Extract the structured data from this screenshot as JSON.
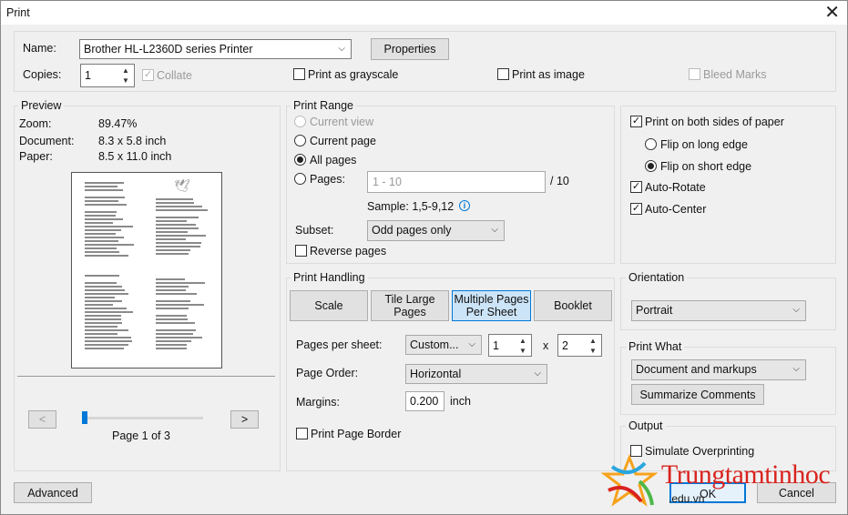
{
  "window": {
    "title": "Print"
  },
  "printer": {
    "name_label": "Name:",
    "name_value": "Brother HL-L2360D series Printer",
    "properties_label": "Properties",
    "copies_label": "Copies:",
    "copies_value": "1",
    "collate_label": "Collate",
    "grayscale_label": "Print as grayscale",
    "as_image_label": "Print as image",
    "bleed_label": "Bleed Marks"
  },
  "preview": {
    "title": "Preview",
    "zoom_label": "Zoom:",
    "zoom_value": "89.47%",
    "document_label": "Document:",
    "document_value": "8.3 x 5.8 inch",
    "paper_label": "Paper:",
    "paper_value": "8.5 x 11.0 inch",
    "prev_label": "<",
    "next_label": ">",
    "page_text": "Page 1 of 3",
    "page_current": 1,
    "page_total": 3
  },
  "range": {
    "title": "Print Range",
    "current_view": "Current view",
    "current_page": "Current page",
    "all_pages": "All pages",
    "pages_label": "Pages:",
    "pages_placeholder": "1 - 10",
    "pages_total": "/ 10",
    "sample": "Sample: 1,5-9,12",
    "subset_label": "Subset:",
    "subset_value": "Odd pages only",
    "reverse_label": "Reverse pages"
  },
  "handling": {
    "title": "Print Handling",
    "tabs": [
      "Scale",
      "Tile Large Pages",
      "Multiple Pages Per Sheet",
      "Booklet"
    ],
    "pps_label": "Pages per sheet:",
    "pps_value": "Custom...",
    "pps_x": "1",
    "pps_times": "x",
    "pps_y": "2",
    "order_label": "Page Order:",
    "order_value": "Horizontal",
    "margins_label": "Margins:",
    "margins_value": "0.200",
    "margins_unit": "inch",
    "border_label": "Print Page Border"
  },
  "duplex": {
    "both_sides": "Print on both sides of paper",
    "long_edge": "Flip on long edge",
    "short_edge": "Flip on short edge",
    "auto_rotate": "Auto-Rotate",
    "auto_center": "Auto-Center"
  },
  "orientation": {
    "title": "Orientation",
    "value": "Portrait"
  },
  "print_what": {
    "title": "Print What",
    "value": "Document and markups",
    "summarize": "Summarize Comments"
  },
  "output": {
    "title": "Output",
    "simulate": "Simulate Overprinting"
  },
  "footer": {
    "advanced": "Advanced",
    "ok": "OK",
    "cancel": "Cancel"
  },
  "watermark": {
    "text": "Trungtamtinhoc",
    "sub": ".edu.vn"
  },
  "colors": {
    "accent": "#0078d7",
    "watermark_red": "#d9231f"
  }
}
